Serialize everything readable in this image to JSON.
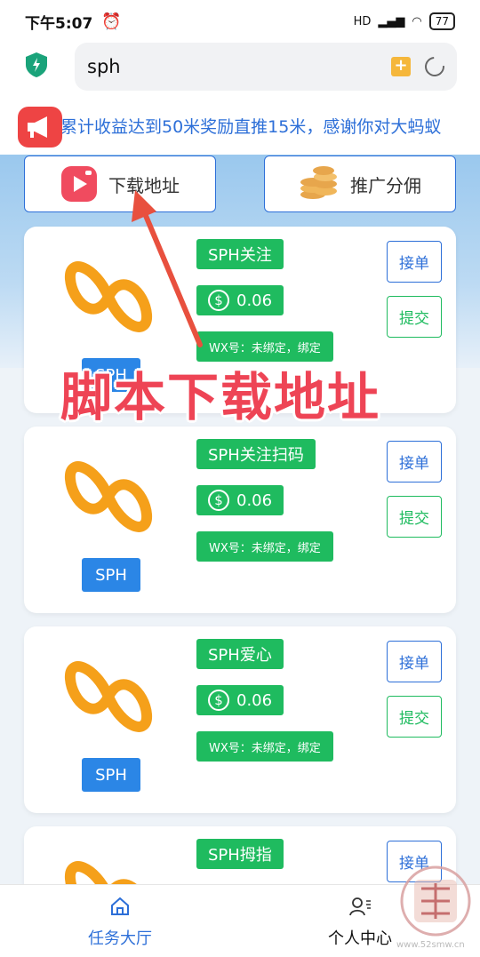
{
  "status": {
    "time": "下午5:07",
    "battery": "77",
    "net": "HD"
  },
  "url": {
    "text": "sph"
  },
  "marquee": {
    "text": "累计收益达到50米奖励直推15米，感谢你对大蚂蚁"
  },
  "top_buttons": {
    "download": "下载地址",
    "promote": "推广分佣"
  },
  "overlay": {
    "text": "脚本下载地址"
  },
  "cards": [
    {
      "title": "SPH关注",
      "price": "0.06",
      "wx": "WX号：未绑定，绑定",
      "tag": "SPH",
      "accept": "接单",
      "submit": "提交"
    },
    {
      "title": "SPH关注扫码",
      "price": "0.06",
      "wx": "WX号：未绑定，绑定",
      "tag": "SPH",
      "accept": "接单",
      "submit": "提交"
    },
    {
      "title": "SPH爱心",
      "price": "0.06",
      "wx": "WX号：未绑定，绑定",
      "tag": "SPH",
      "accept": "接单",
      "submit": "提交"
    },
    {
      "title": "SPH拇指",
      "accept": "接单"
    }
  ],
  "nav": {
    "tasks": "任务大厅",
    "profile": "个人中心"
  },
  "watermark": {
    "url": "www.52smw.cn"
  },
  "colors": {
    "accent_blue": "#2d6fd8",
    "green": "#1fbb5f",
    "logo_orange": "#f5a01a",
    "overlay_red": "#ee4455"
  }
}
